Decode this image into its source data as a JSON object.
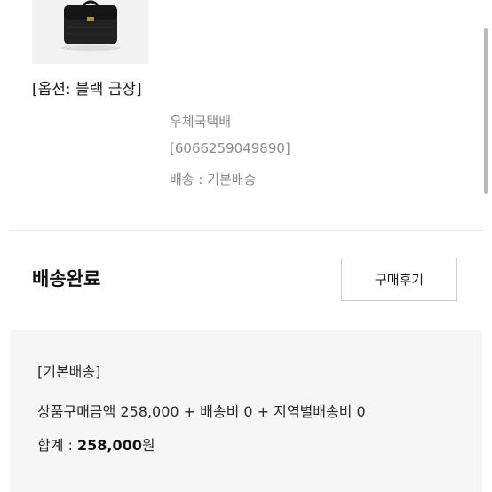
{
  "product": {
    "image_name": "black-bag-image",
    "option": "[옵션: 블랙 금장]"
  },
  "shipping": {
    "carrier": "우체국택배",
    "tracking_number": "[6066259049890]",
    "method": "배송 : 기본배송"
  },
  "status": {
    "title": "배송완료",
    "review_button": "구매후기"
  },
  "summary": {
    "tag": "[기본배송]",
    "calculation": "상품구매금액 258,000 + 배송비 0 + 지역별배송비 0",
    "total_label": "합계 : ",
    "total_amount": "258,000",
    "total_unit": "원"
  },
  "colors": {
    "summary_background": "#f6f6f6",
    "secondary_text": "#8a8a8a",
    "button_border": "#cfcfcf"
  }
}
